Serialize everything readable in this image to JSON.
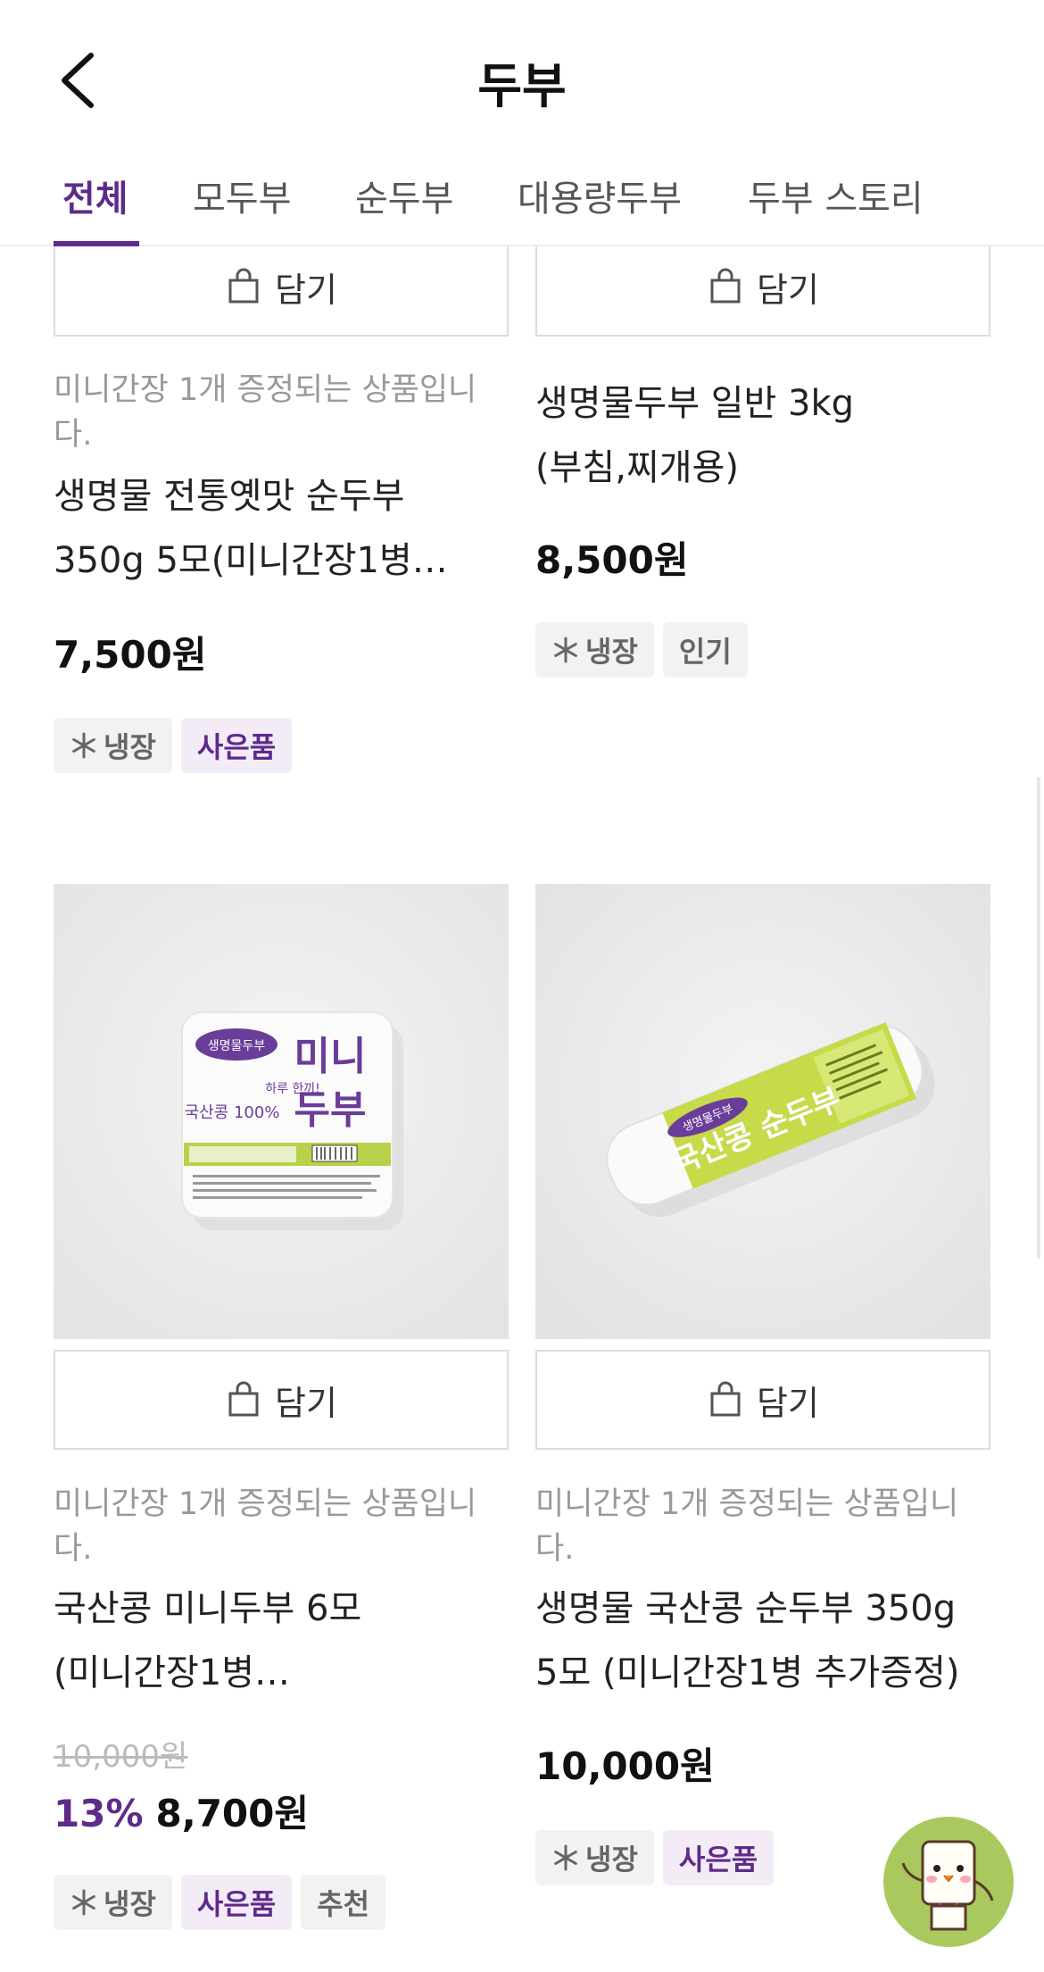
{
  "header": {
    "title": "두부",
    "back_icon": "chevron-left-icon"
  },
  "tabs": [
    {
      "label": "전체",
      "active": true
    },
    {
      "label": "모두부",
      "active": false
    },
    {
      "label": "순두부",
      "active": false
    },
    {
      "label": "대용량두부",
      "active": false
    },
    {
      "label": "두부 스토리",
      "active": false
    }
  ],
  "colors": {
    "accent": "#5f2b8a",
    "tag_bg": "#f2f2f2",
    "gift_tag_bg": "#f3ecf7"
  },
  "products": [
    {
      "cart_label": "담기",
      "promo": "미니간장 1개 증정되는 상품입니다.",
      "name_line1": "생명물 전통옛맛 순두부",
      "name_line2": "350g 5모(미니간장1병…",
      "price": "7,500원",
      "tags": [
        "냉장",
        "사은품"
      ]
    },
    {
      "cart_label": "담기",
      "name_line1": "생명물두부 일반 3kg",
      "name_line2": "(부침,찌개용)",
      "price": "8,500원",
      "tags": [
        "냉장",
        "인기"
      ]
    },
    {
      "cart_label": "담기",
      "promo": "미니간장 1개 증정되는 상품입니다.",
      "name_line1": "국산콩 미니두부 6모",
      "name_line2": "(미니간장1병…",
      "original_price": "10,000원",
      "discount": "13%",
      "price": "8,700원",
      "tags": [
        "냉장",
        "사은품",
        "추천"
      ],
      "image_text": {
        "brand": "생명물두부",
        "title1": "미니",
        "title2": "두부",
        "slogan": "하루 한끼!",
        "badge": "국산콩 100%"
      }
    },
    {
      "cart_label": "담기",
      "promo": "미니간장 1개 증정되는 상품입니다.",
      "name_line1": "생명물 국산콩 순두부 350g",
      "name_line2": "5모 (미니간장1병 추가증정)",
      "price": "10,000원",
      "tags": [
        "냉장",
        "사은품"
      ],
      "image_text": {
        "brand": "생명물두부",
        "title": "국산콩 순두부"
      }
    }
  ]
}
